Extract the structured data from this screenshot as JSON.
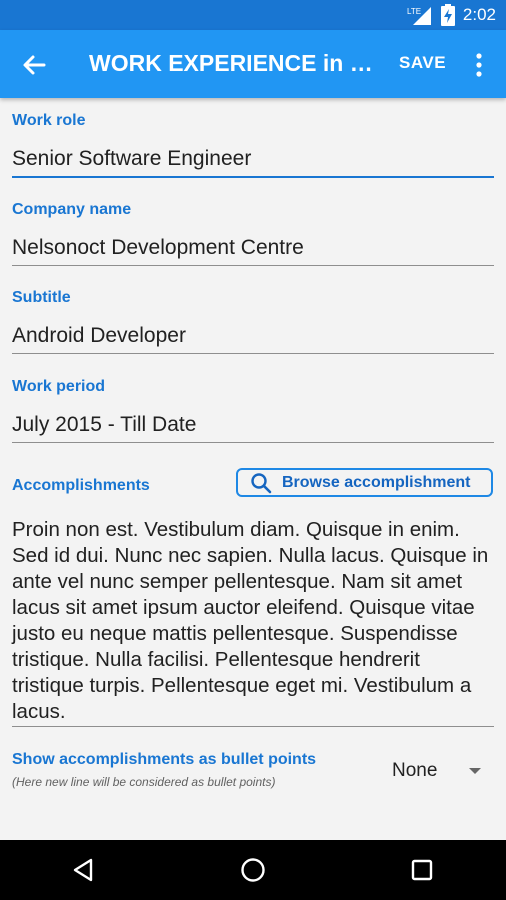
{
  "status_bar": {
    "network": "LTE",
    "time": "2:02"
  },
  "app_bar": {
    "title": "WORK EXPERIENCE in d…",
    "save_label": "SAVE"
  },
  "form": {
    "work_role": {
      "label": "Work role",
      "value": "Senior Software Engineer"
    },
    "company_name": {
      "label": "Company name",
      "value": "Nelsonoct Development Centre"
    },
    "subtitle": {
      "label": "Subtitle",
      "value": "Android Developer"
    },
    "work_period": {
      "label": "Work period",
      "value": "July 2015 - Till Date"
    },
    "accomplishments": {
      "label": "Accomplishments",
      "browse_label": "Browse accomplishment",
      "text": "Proin non est. Vestibulum diam. Quisque in enim. Sed id dui. Nunc nec sapien. Nulla lacus. Quisque in ante vel nunc semper pellentesque. Nam sit amet lacus sit amet ipsum auctor eleifend. Quisque vitae justo eu neque mattis pellentesque. Suspendisse tristique. Nulla facilisi. Pellentesque hendrerit tristique turpis. Pellentesque eget mi. Vestibulum a lacus."
    },
    "bullet_points": {
      "label": "Show accomplishments as bullet points",
      "hint": "(Here new line will be considered as bullet points)",
      "selected": "None"
    }
  },
  "colors": {
    "primary": "#2196f3",
    "primary_dark": "#1976d2",
    "accent_text": "#1976d2"
  },
  "icons": {
    "back": "arrow-left-icon",
    "more": "more-vert-icon",
    "search": "search-icon",
    "dropdown": "triangle-down-icon",
    "nav_back": "nav-back-icon",
    "nav_home": "nav-home-icon",
    "nav_recents": "nav-recents-icon"
  }
}
